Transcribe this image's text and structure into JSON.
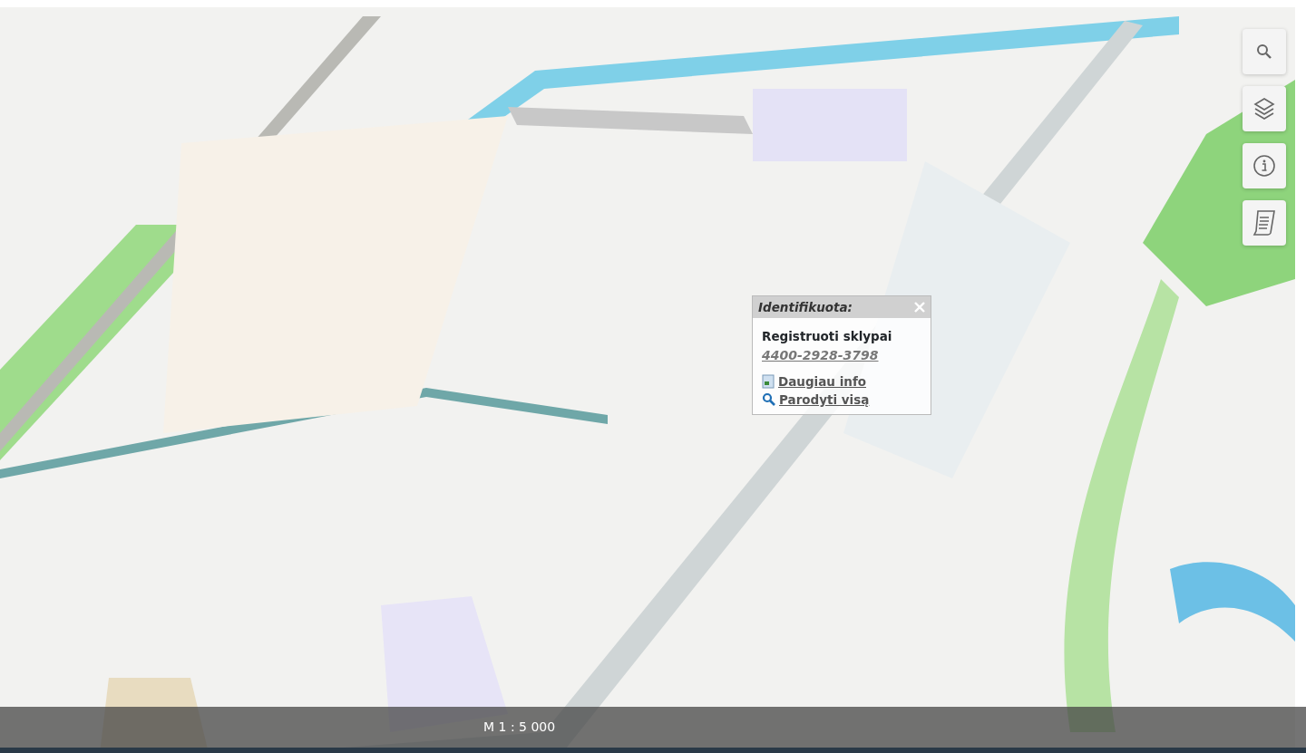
{
  "toolbar": [
    {
      "kind": "search"
    },
    {
      "kind": "layers"
    },
    {
      "kind": "info"
    },
    {
      "kind": "legend"
    }
  ],
  "popup": {
    "title": "Identifikuota:",
    "layer": "Registruoti sklypai",
    "parcel_number": "4400-2928-3798",
    "links": [
      {
        "kind": "info",
        "label": "Daugiau info"
      },
      {
        "kind": "zoom",
        "label": "Parodyti visą"
      }
    ]
  },
  "scale": "M 1 : 5 000"
}
